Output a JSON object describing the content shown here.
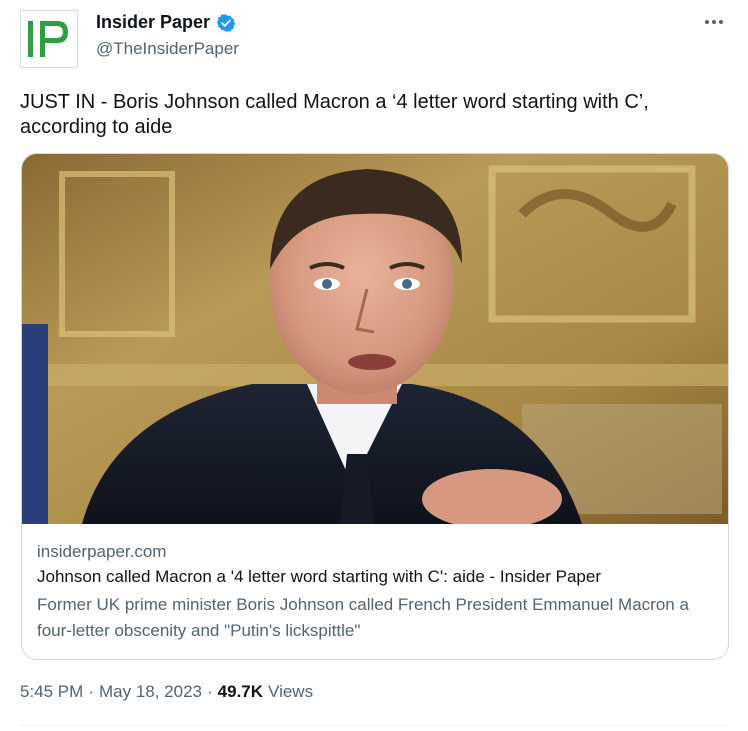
{
  "account": {
    "display_name": "Insider Paper",
    "handle": "@TheInsiderPaper",
    "avatar_letters": "IP",
    "verified": true
  },
  "tweet": {
    "text": "JUST IN - Boris Johnson called Macron a ‘4 letter word starting with C’, according to aide"
  },
  "link_card": {
    "domain": "insiderpaper.com",
    "title": "Johnson called Macron a '4 letter word starting with C': aide - Insider Paper",
    "description": "Former UK prime minister Boris Johnson called French President Emmanuel Macron a four-letter obscenity and \"Putin's lickspittle\""
  },
  "footer": {
    "time": "5:45 PM",
    "separator": "·",
    "date": "May 18, 2023",
    "views_count": "49.7K",
    "views_label": "Views"
  },
  "colors": {
    "brand_green": "#2f9e44",
    "verified_blue": "#1d9bf0",
    "secondary_text": "#536471"
  },
  "icons": {
    "verified": "verified-badge-icon",
    "more": "more-horizontal-icon"
  }
}
